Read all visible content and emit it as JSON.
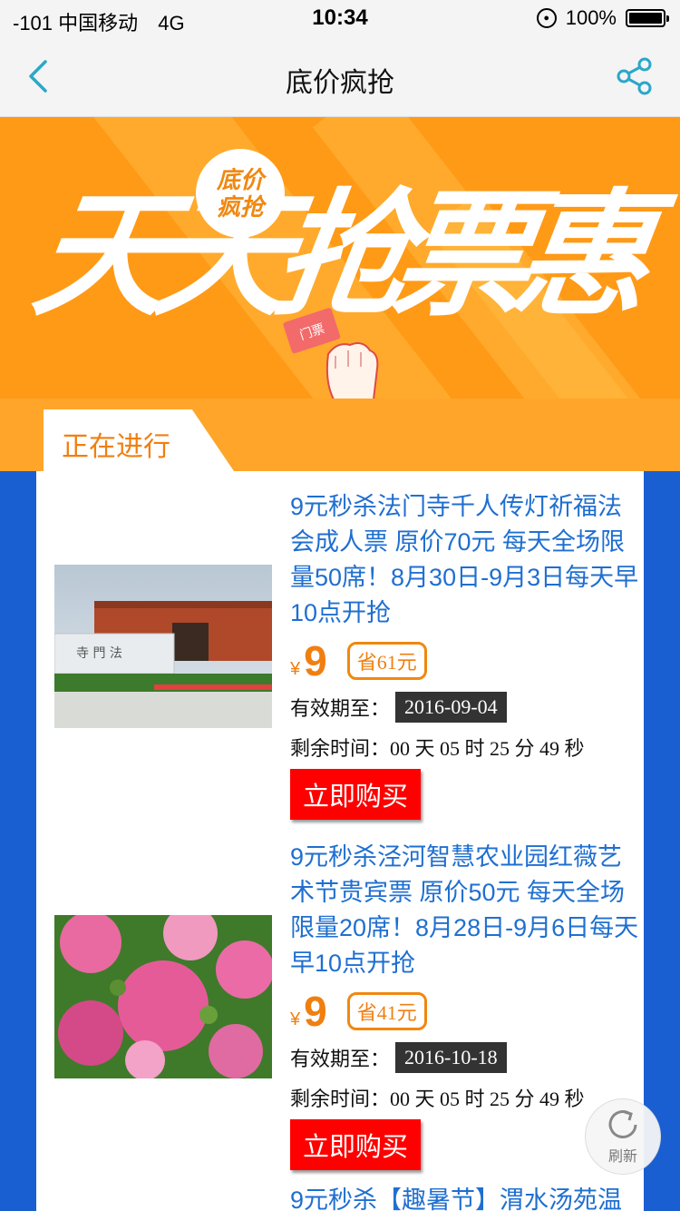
{
  "status_bar": {
    "carrier": "-101 中国移动",
    "network": "4G",
    "time": "10:34",
    "battery": "100%"
  },
  "nav": {
    "title": "底价疯抢",
    "back_icon": "chevron-left-icon",
    "share_icon": "share-icon",
    "accent_color": "#2aa7c9"
  },
  "banner": {
    "badge_line1": "底价",
    "badge_line2": "疯抢",
    "headline": "天天抢票惠",
    "ticket_text": "门票",
    "background_color": "#ff9a16"
  },
  "tabs": {
    "active_label": "正在进行"
  },
  "deals": [
    {
      "title": "9元秒杀法门寺千人传灯祈福法会成人票 原价70元 每天全场限量50席！8月30日-9月3日每天早10点开抢",
      "currency": "¥",
      "price": "9",
      "save": "省61元",
      "valid_label": "有效期至：",
      "valid_date": "2016-09-04",
      "remain_label": "剩余时间：",
      "remain_value": "00 天 05 时 25 分 49 秒",
      "buy_label": "立即购买",
      "image": "temple-gate-photo"
    },
    {
      "title": "9元秒杀泾河智慧农业园红薇艺术节贵宾票 原价50元 每天全场限量20席！8月28日-9月6日每天早10点开抢",
      "currency": "¥",
      "price": "9",
      "save": "省41元",
      "valid_label": "有效期至：",
      "valid_date": "2016-10-18",
      "remain_label": "剩余时间：",
      "remain_value": "00 天 05 时 25 分 49 秒",
      "buy_label": "立即购买",
      "image": "pink-flowers-photo"
    },
    {
      "title": "9元秒杀【趣暑节】渭水汤苑温"
    }
  ],
  "refresh": {
    "label": "刷新",
    "icon": "refresh-icon"
  }
}
